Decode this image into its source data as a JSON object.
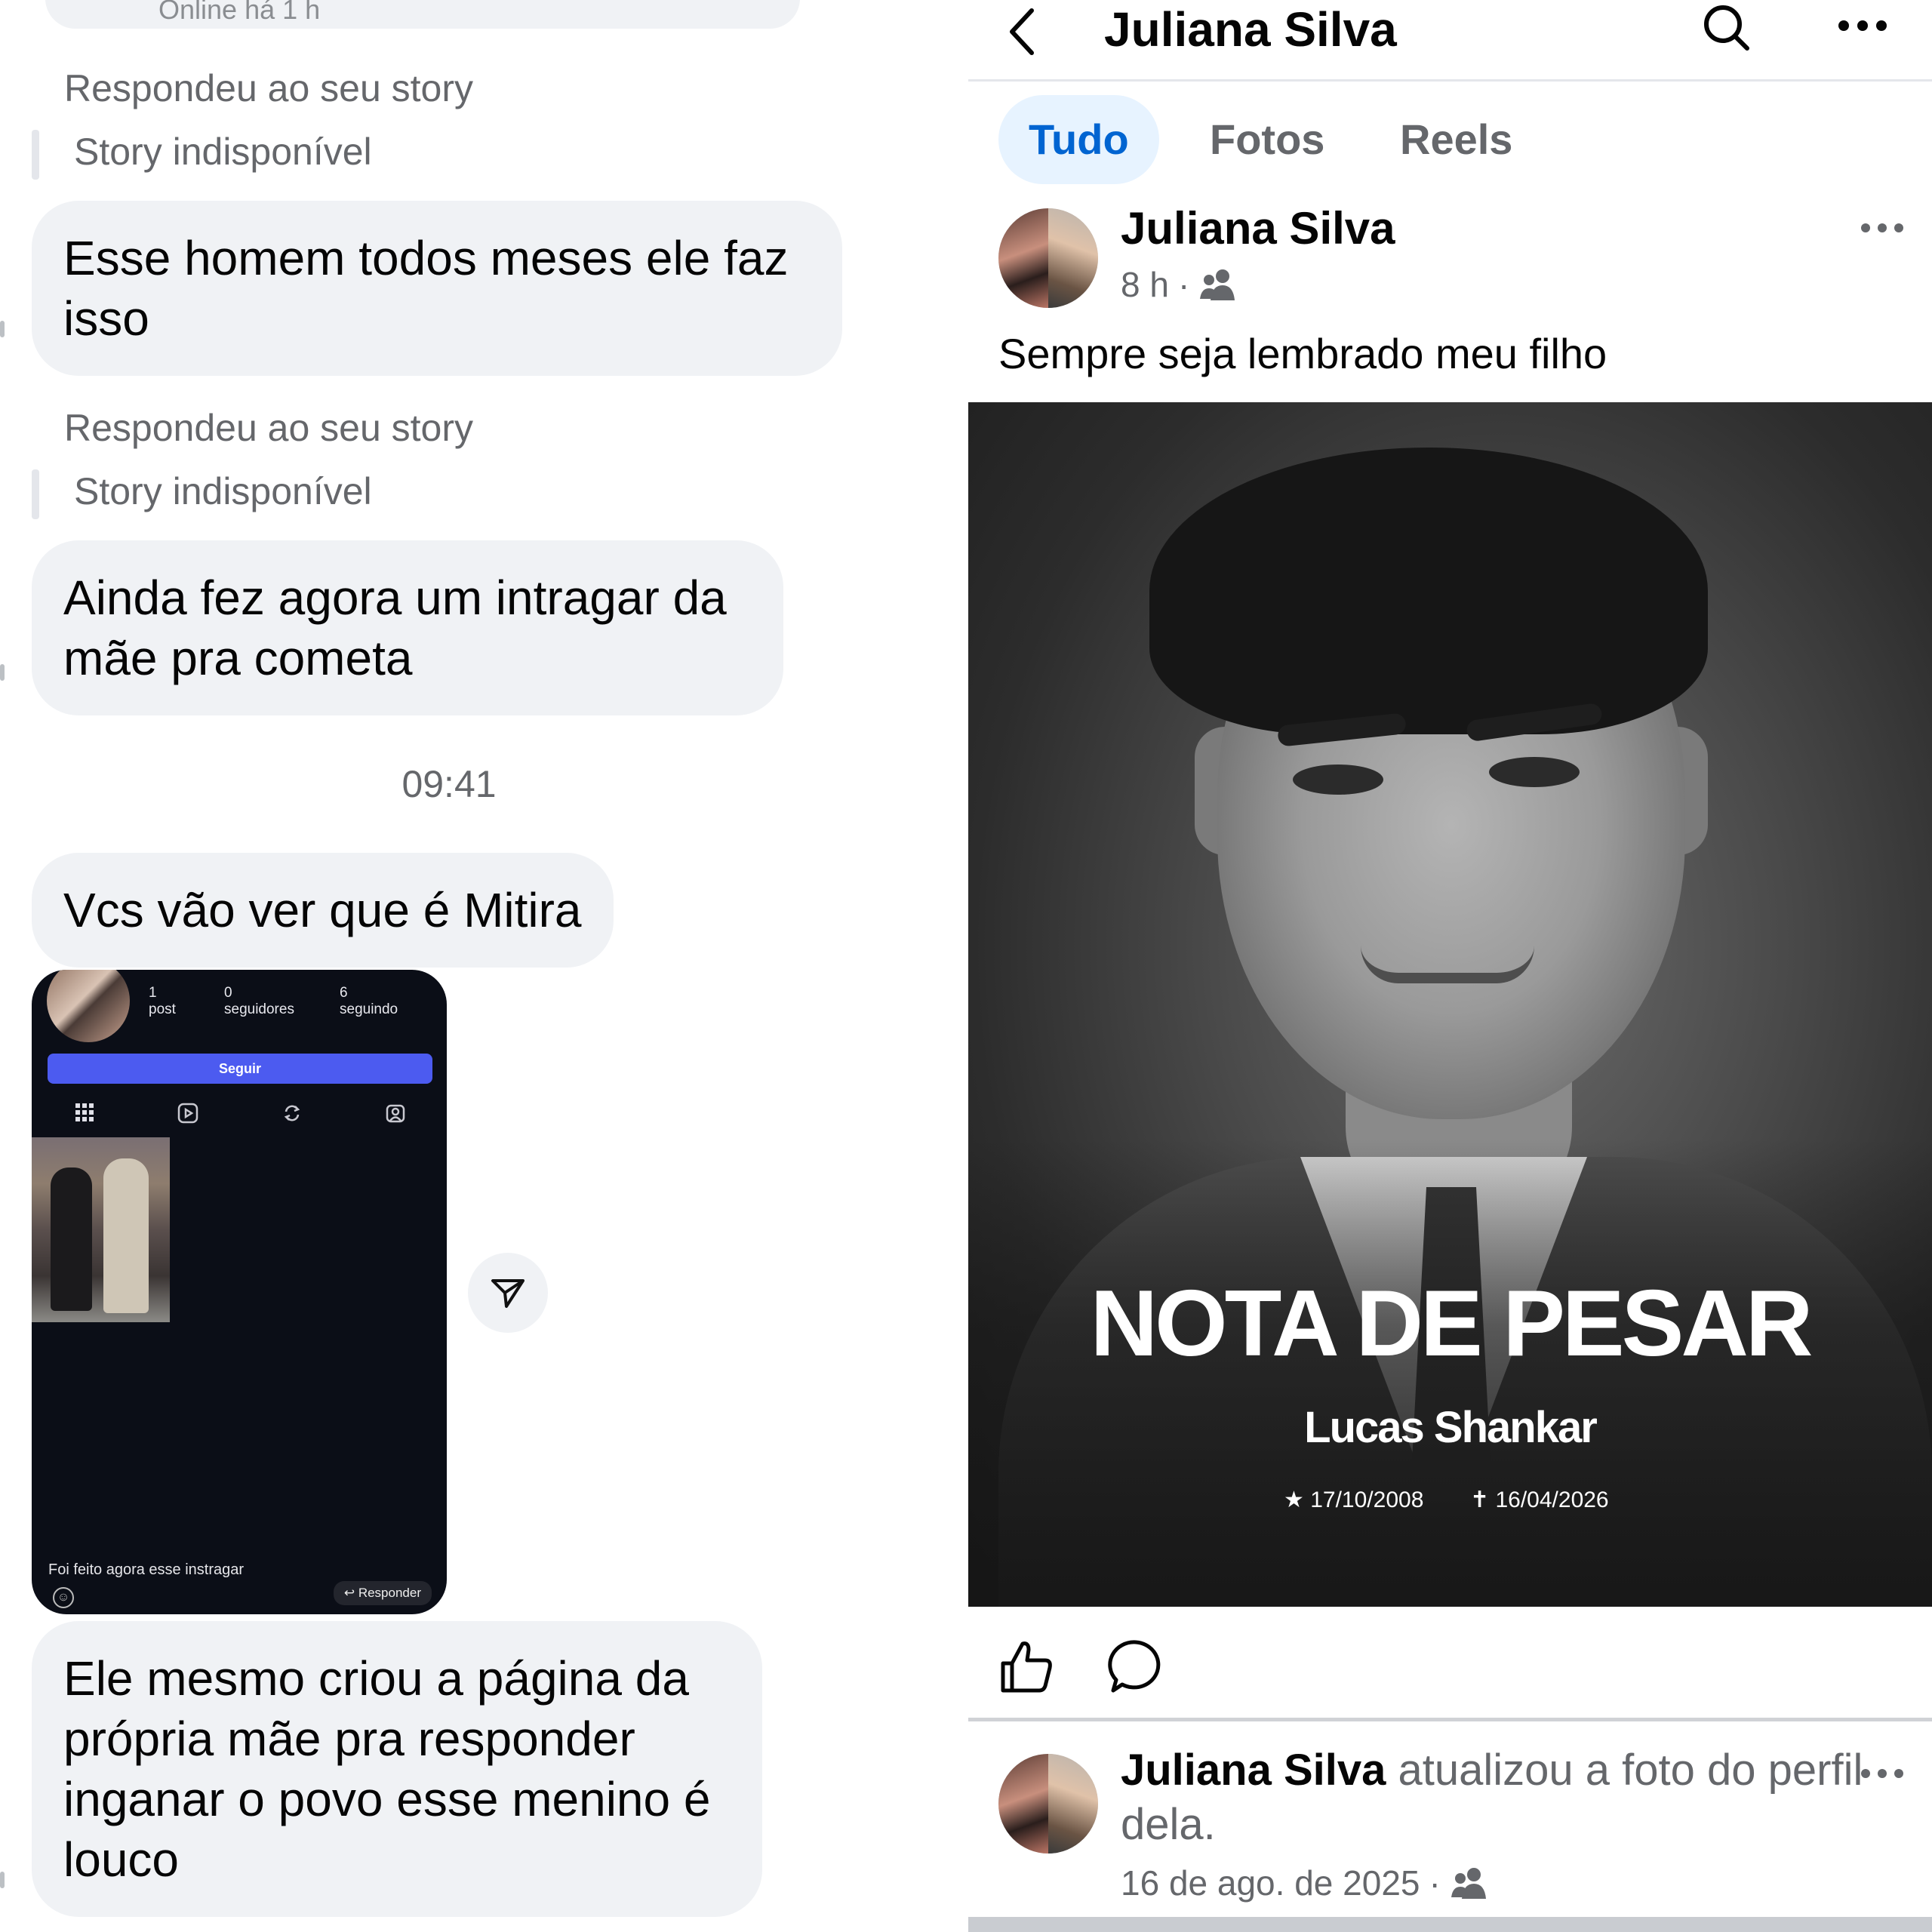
{
  "chat": {
    "top_partial": "Online há 1 h",
    "reply_label": "Respondeu ao seu story",
    "story_unavailable": "Story indisponível",
    "messages": [
      "Esse homem todos meses ele faz isso",
      "Ainda fez agora um intragar da mãe pra cometa",
      "Vcs vão ver que é Mitira",
      "Ele mesmo criou a página da própria mãe pra responder inganar o povo esse menino é louco"
    ],
    "time": "09:41",
    "shared_screenshot": {
      "stats": [
        {
          "value": "1",
          "label": "post"
        },
        {
          "value": "0",
          "label": "seguidores"
        },
        {
          "value": "6",
          "label": "seguindo"
        }
      ],
      "follow_button": "Seguir",
      "caption": "Foi feito agora esse instragar",
      "reply_button": "Responder",
      "tab_icons": [
        "grid-icon",
        "reels-icon",
        "repost-icon",
        "tagged-icon"
      ]
    },
    "share_icon": "send-icon"
  },
  "facebook": {
    "header_title": "Juliana Silva",
    "header_icons": [
      "back-icon",
      "search-icon",
      "more-icon"
    ],
    "tabs": [
      "Tudo",
      "Fotos",
      "Reels"
    ],
    "active_tab": "Tudo",
    "post": {
      "author": "Juliana Silva",
      "time": "8 h",
      "separator": "·",
      "audience_icon": "friends-icon",
      "text": "Sempre seja lembrado meu filho",
      "image": {
        "headline": "NOTA DE PESAR",
        "name": "Lucas Shankar",
        "born": "★ 17/10/2008",
        "died": "✝ 16/04/2026"
      }
    },
    "actions": [
      "like-icon",
      "comment-icon"
    ],
    "activity": {
      "author": "Juliana Silva",
      "text": " atualizou a foto do perfil dela.",
      "date": "16 de ago. de 2025",
      "separator": "·"
    },
    "colors": {
      "active_tab_bg": "#e7f3ff",
      "active_tab_text": "#0064d1",
      "bubble_bg": "#f0f2f5",
      "secondary_text": "#65676b"
    }
  }
}
